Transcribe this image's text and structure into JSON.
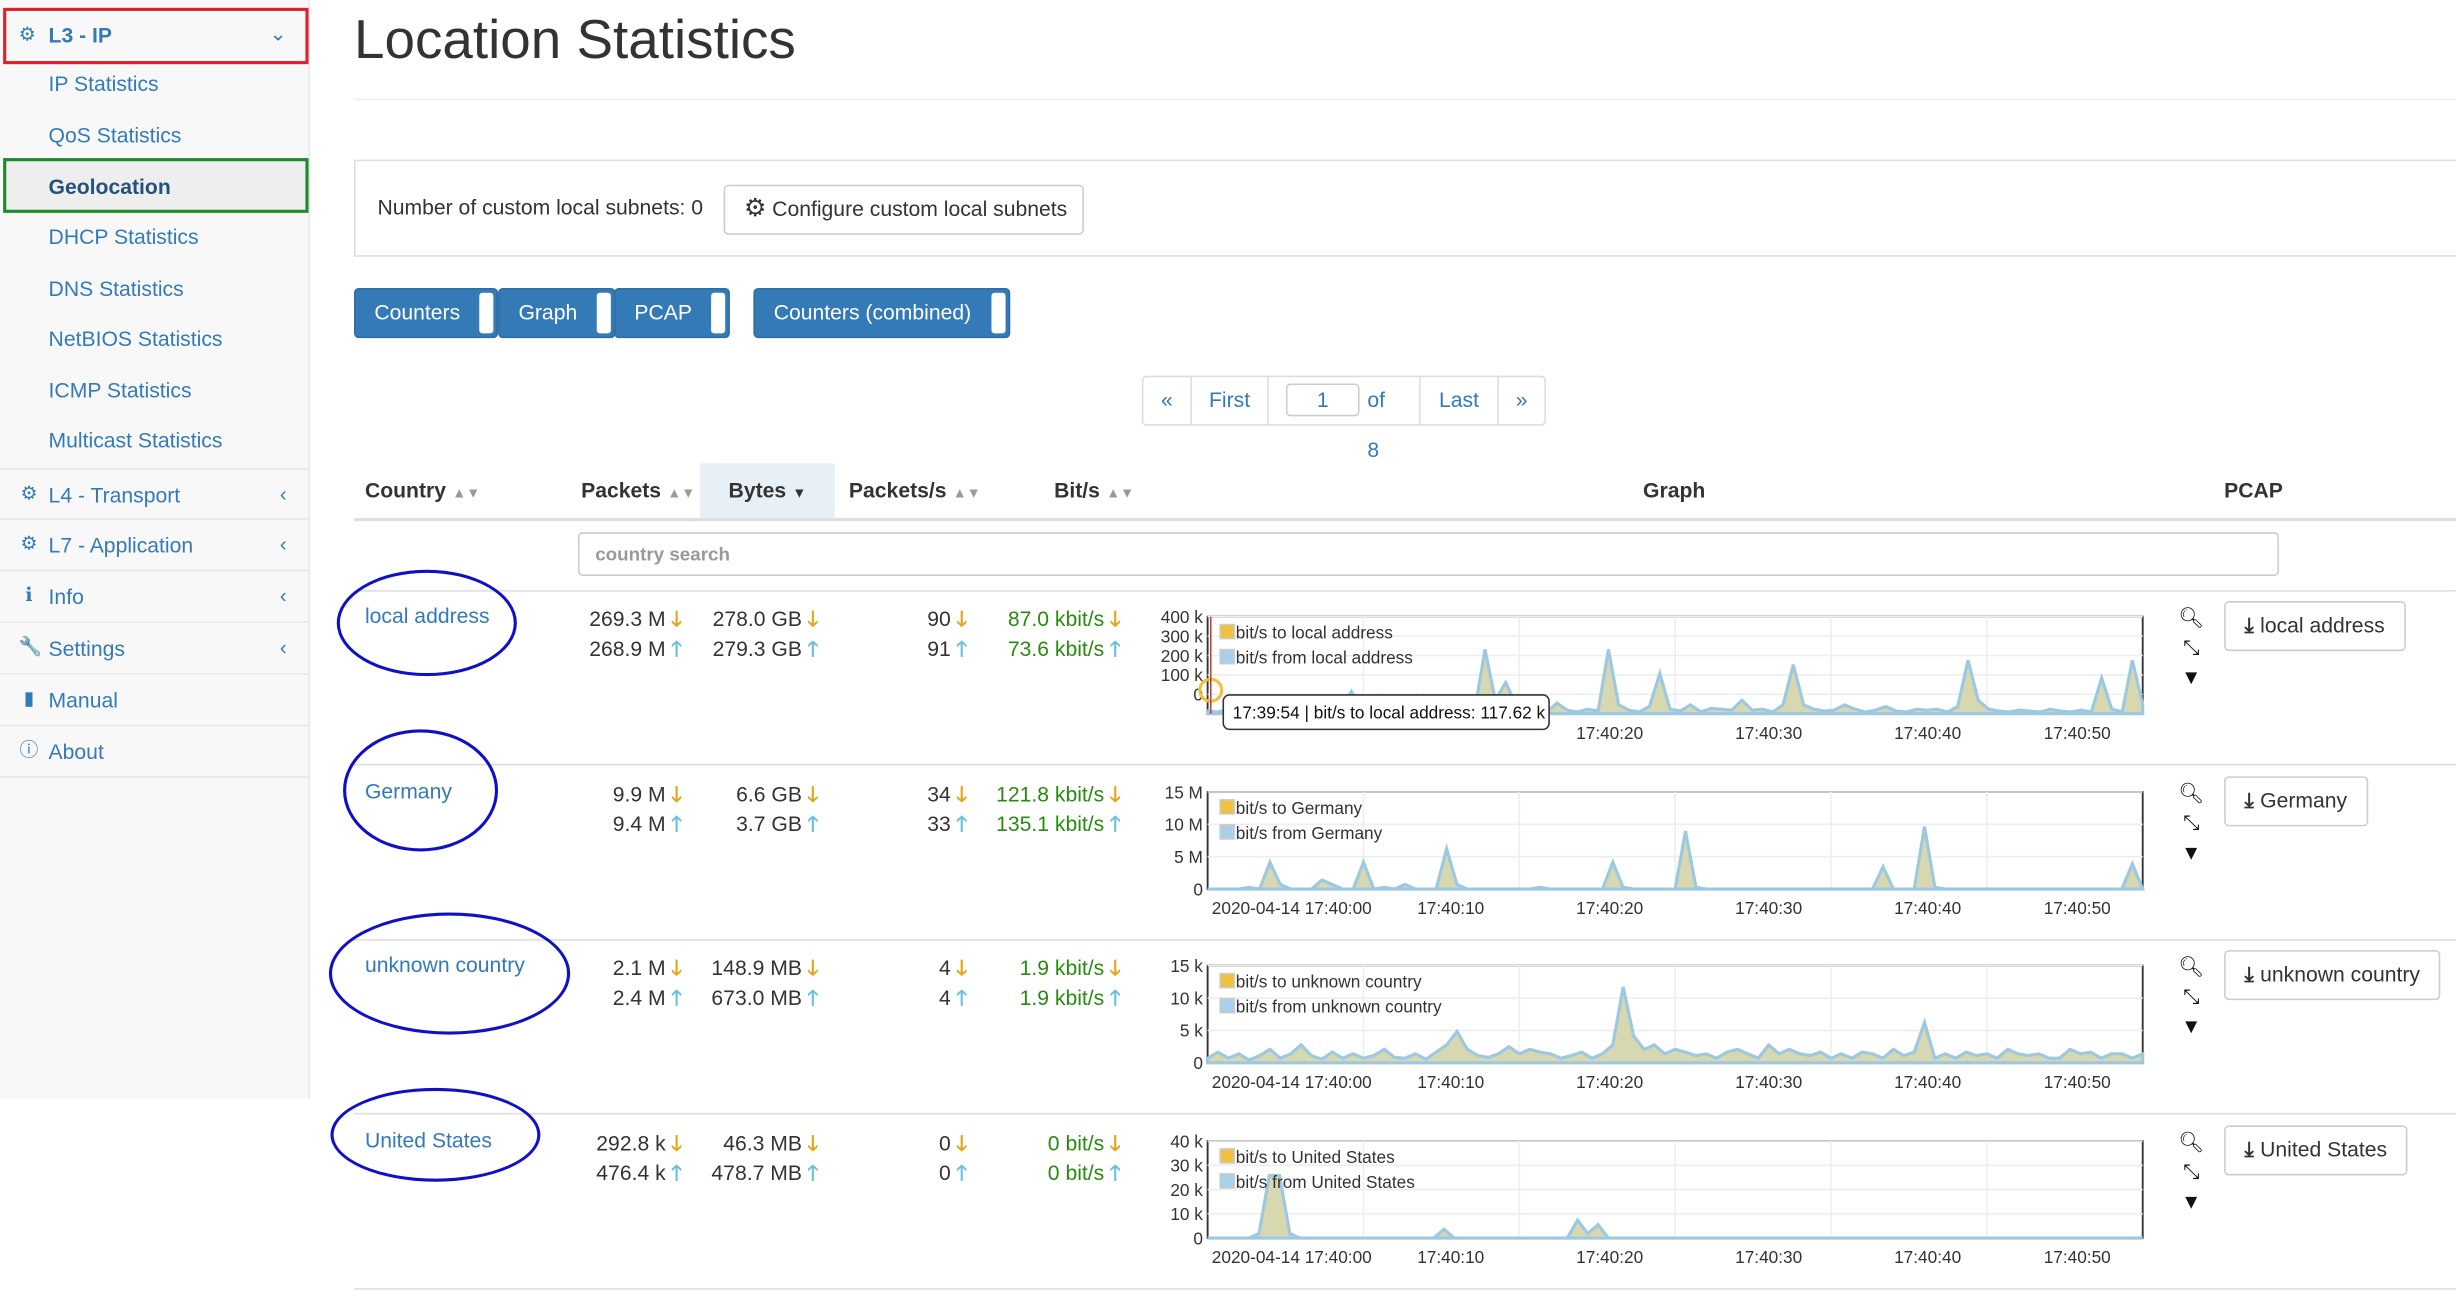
{
  "sidebar": {
    "l3": {
      "label": "L3 - IP",
      "icon": "gear-icon"
    },
    "sub_items": [
      {
        "label": "IP Statistics"
      },
      {
        "label": "QoS Statistics"
      },
      {
        "label": "Geolocation",
        "active": true
      },
      {
        "label": "DHCP Statistics"
      },
      {
        "label": "DNS Statistics"
      },
      {
        "label": "NetBIOS Statistics"
      },
      {
        "label": "ICMP Statistics"
      },
      {
        "label": "Multicast Statistics"
      }
    ],
    "items": [
      {
        "label": "L4 - Transport",
        "icon": "gear-icon"
      },
      {
        "label": "L7 - Application",
        "icon": "gear-icon"
      },
      {
        "label": "Info",
        "icon": "info-icon"
      },
      {
        "label": "Settings",
        "icon": "wrench-icon"
      },
      {
        "label": "Manual",
        "icon": "book-icon"
      },
      {
        "label": "About",
        "icon": "info-circle-icon"
      }
    ]
  },
  "page": {
    "title": "Location Statistics"
  },
  "subnets": {
    "text": "Number of custom local subnets: 0",
    "button": "Configure custom local subnets"
  },
  "toggles": [
    "Counters",
    "Graph",
    "PCAP",
    "Counters (combined)"
  ],
  "pagination": {
    "prev": "«",
    "first": "First",
    "page": "1",
    "of": "of 8",
    "last": "Last",
    "next": "»"
  },
  "table": {
    "headers": {
      "country": "Country",
      "packets": "Packets",
      "bytes": "Bytes",
      "packets_s": "Packets/s",
      "bits_s": "Bit/s",
      "graph": "Graph",
      "pcap": "PCAP"
    },
    "search_placeholder": "country search",
    "rows": [
      {
        "country": "local address",
        "packets_down": "269.3 M",
        "packets_up": "268.9 M",
        "bytes_down": "278.0 GB",
        "bytes_up": "279.3 GB",
        "pps_down": "90",
        "pps_up": "91",
        "bps_down": "87.0 kbit/s",
        "bps_up": "73.6 kbit/s",
        "legend_to": "bit/s to local address",
        "legend_from": "bit/s from local address",
        "y_ticks": [
          "400 k",
          "300 k",
          "200 k",
          "100 k",
          "0"
        ],
        "x_ticks": [
          "17:40:20",
          "17:40:30",
          "17:40:40",
          "17:40:50"
        ],
        "tooltip": "17:39:54 | bit/s to local address: 117.62 k",
        "pcap_label": "local address"
      },
      {
        "country": "Germany",
        "packets_down": "9.9 M",
        "packets_up": "9.4 M",
        "bytes_down": "6.6 GB",
        "bytes_up": "3.7 GB",
        "pps_down": "34",
        "pps_up": "33",
        "bps_down": "121.8 kbit/s",
        "bps_up": "135.1 kbit/s",
        "legend_to": "bit/s to Germany",
        "legend_from": "bit/s from Germany",
        "y_ticks": [
          "15 M",
          "10 M",
          "5 M",
          "0"
        ],
        "x_ticks": [
          "2020-04-14 17:40:00",
          "17:40:10",
          "17:40:20",
          "17:40:30",
          "17:40:40",
          "17:40:50"
        ],
        "pcap_label": "Germany"
      },
      {
        "country": "unknown country",
        "packets_down": "2.1 M",
        "packets_up": "2.4 M",
        "bytes_down": "148.9 MB",
        "bytes_up": "673.0 MB",
        "pps_down": "4",
        "pps_up": "4",
        "bps_down": "1.9 kbit/s",
        "bps_up": "1.9 kbit/s",
        "legend_to": "bit/s to unknown country",
        "legend_from": "bit/s from unknown country",
        "y_ticks": [
          "15 k",
          "10 k",
          "5 k",
          "0"
        ],
        "x_ticks": [
          "2020-04-14 17:40:00",
          "17:40:10",
          "17:40:20",
          "17:40:30",
          "17:40:40",
          "17:40:50"
        ],
        "pcap_label": "unknown country"
      },
      {
        "country": "United States",
        "packets_down": "292.8 k",
        "packets_up": "476.4 k",
        "bytes_down": "46.3 MB",
        "bytes_up": "478.7 MB",
        "pps_down": "0",
        "pps_up": "0",
        "bps_down": "0 bit/s",
        "bps_up": "0 bit/s",
        "legend_to": "bit/s to United States",
        "legend_from": "bit/s from United States",
        "y_ticks": [
          "40 k",
          "30 k",
          "20 k",
          "10 k",
          "0"
        ],
        "x_ticks": [
          "2020-04-14 17:40:00",
          "17:40:10",
          "17:40:20",
          "17:40:30",
          "17:40:40",
          "17:40:50"
        ],
        "pcap_label": "United States"
      }
    ]
  },
  "colors": {
    "link": "#337ab7",
    "primary": "#337ab7",
    "down_arrow": "#e8a317",
    "up_arrow": "#6ac0e0",
    "rate_green": "#2a8a10",
    "highlight_red": "#e0202a",
    "highlight_green": "#1f8a2c",
    "annotation_blue": "#1010c8"
  }
}
